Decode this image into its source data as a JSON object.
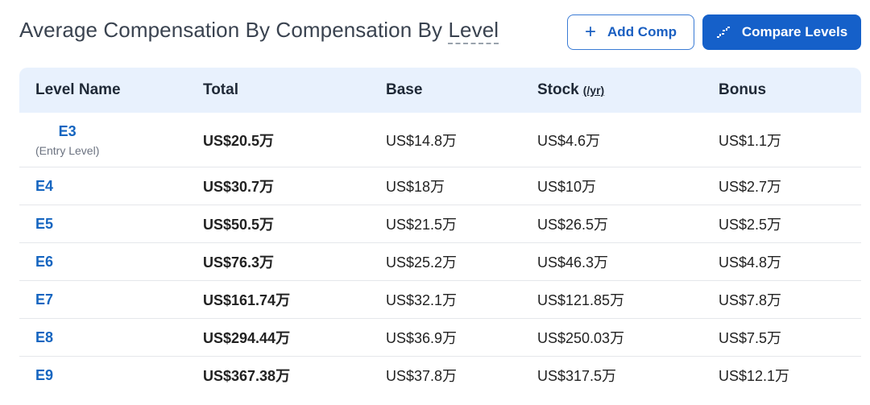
{
  "header": {
    "title_prefix": "Average Compensation By Compensation By ",
    "title_level": "Level",
    "add_comp_label": "Add Comp",
    "compare_levels_label": "Compare Levels"
  },
  "table": {
    "columns": {
      "level_name": "Level Name",
      "total": "Total",
      "base": "Base",
      "stock": "Stock",
      "stock_unit": "(/yr)",
      "bonus": "Bonus"
    },
    "rows": [
      {
        "level": "E3",
        "sub": "(Entry Level)",
        "total": "US$20.5万",
        "base": "US$14.8万",
        "stock": "US$4.6万",
        "bonus": "US$1.1万"
      },
      {
        "level": "E4",
        "total": "US$30.7万",
        "base": "US$18万",
        "stock": "US$10万",
        "bonus": "US$2.7万"
      },
      {
        "level": "E5",
        "total": "US$50.5万",
        "base": "US$21.5万",
        "stock": "US$26.5万",
        "bonus": "US$2.5万"
      },
      {
        "level": "E6",
        "total": "US$76.3万",
        "base": "US$25.2万",
        "stock": "US$46.3万",
        "bonus": "US$4.8万"
      },
      {
        "level": "E7",
        "total": "US$161.74万",
        "base": "US$32.1万",
        "stock": "US$121.85万",
        "bonus": "US$7.8万"
      },
      {
        "level": "E8",
        "total": "US$294.44万",
        "base": "US$36.9万",
        "stock": "US$250.03万",
        "bonus": "US$7.5万"
      },
      {
        "level": "E9",
        "total": "US$367.38万",
        "base": "US$37.8万",
        "stock": "US$317.5万",
        "bonus": "US$12.1万"
      }
    ]
  },
  "colors": {
    "accent": "#1560c9",
    "link": "#1565c0",
    "header_bg": "#e8f1fd"
  },
  "icons": {
    "add": "plus-icon",
    "compare": "steps-icon"
  }
}
